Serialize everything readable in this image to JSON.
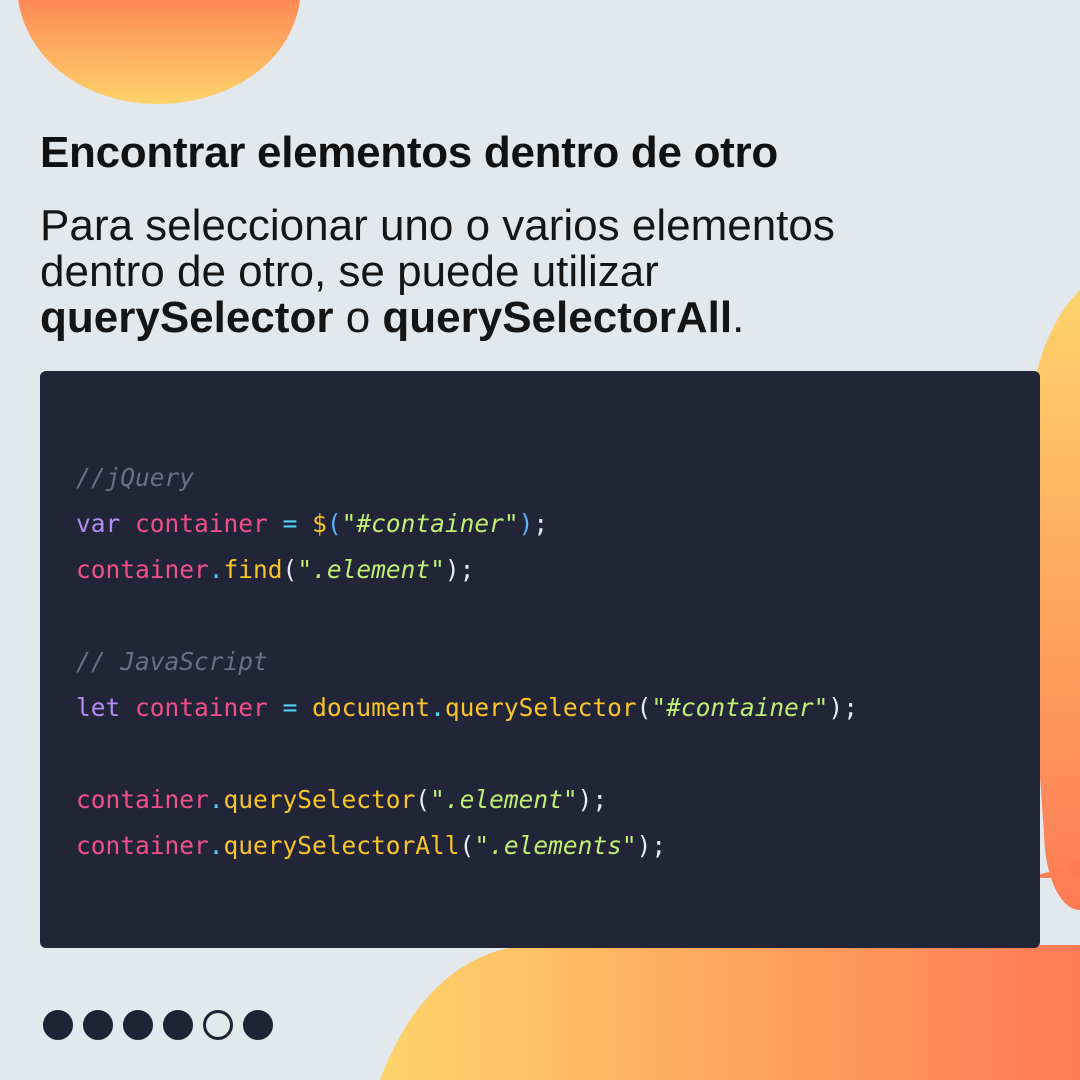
{
  "colors": {
    "background": "#e3e8ec",
    "code_background": "#222538",
    "blob_yellow": "#fdd36a",
    "blob_orange": "#ff7a55"
  },
  "title": "Encontrar elementos dentro de otro",
  "intro": {
    "line1": "Para seleccionar uno o varios elementos",
    "line2": "dentro de otro, se puede utilizar",
    "method1": "querySelector",
    "connector": " o ",
    "method2": "querySelectorAll",
    "end": "."
  },
  "code": {
    "comment_jquery": "//jQuery",
    "kw_var": "var",
    "kw_let": "let",
    "var_container": "container",
    "op_eq": "=",
    "fn_dollar": "$",
    "str_container_id": "\"#container\"",
    "str_element": "\".element\"",
    "str_elements": "\".elements\"",
    "fn_find": "find",
    "comment_js": "// JavaScript",
    "obj_document": "document",
    "fn_qs": "querySelector",
    "fn_qsa": "querySelectorAll",
    "dot": ".",
    "paren_open": "(",
    "paren_close": ")",
    "semi": ";",
    "space": " "
  },
  "pagination": {
    "total": 6,
    "current": 5
  }
}
